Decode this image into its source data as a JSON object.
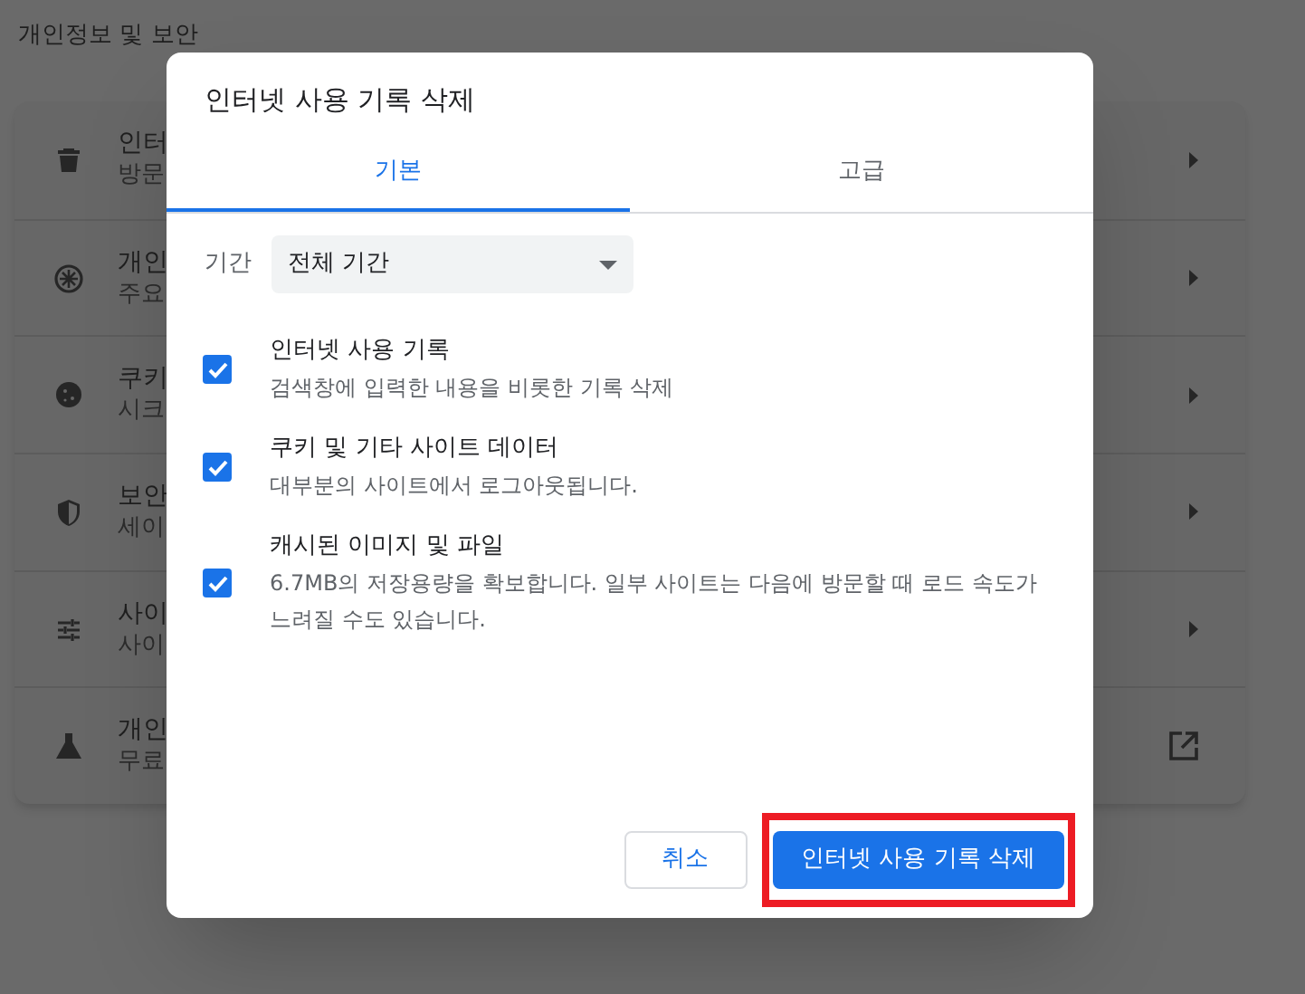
{
  "page": {
    "heading": "개인정보 및 보안",
    "rows": [
      {
        "title": "인터",
        "subtitle": "방문",
        "kind": "submenu"
      },
      {
        "title": "개인",
        "subtitle": "주요",
        "kind": "submenu"
      },
      {
        "title": "쿠키",
        "subtitle": "시크",
        "kind": "submenu"
      },
      {
        "title": "보안",
        "subtitle": "세이",
        "kind": "submenu"
      },
      {
        "title": "사이",
        "subtitle": "사이",
        "kind": "submenu"
      },
      {
        "title": "개인",
        "subtitle": "무료",
        "kind": "link"
      }
    ]
  },
  "dialog": {
    "title": "인터넷 사용 기록 삭제",
    "tabs": [
      {
        "label": "기본",
        "selected": true
      },
      {
        "label": "고급",
        "selected": false
      }
    ],
    "time_range": {
      "label": "기간",
      "value": "전체 기간"
    },
    "options": [
      {
        "title": "인터넷 사용 기록",
        "description": "검색창에 입력한 내용을 비롯한 기록 삭제",
        "checked": true
      },
      {
        "title": "쿠키 및 기타 사이트 데이터",
        "description": "대부분의 사이트에서 로그아웃됩니다.",
        "checked": true
      },
      {
        "title": "캐시된 이미지 및 파일",
        "description": "6.7MB의 저장용량을 확보합니다. 일부 사이트는 다음에 방문할 때 로드 속도가 느려질 수도 있습니다.",
        "checked": true
      }
    ],
    "buttons": [
      {
        "label": "취소",
        "kind": "secondary",
        "highlighted": false
      },
      {
        "label": "인터넷 사용 기록 삭제",
        "kind": "primary",
        "highlighted": true
      }
    ]
  }
}
